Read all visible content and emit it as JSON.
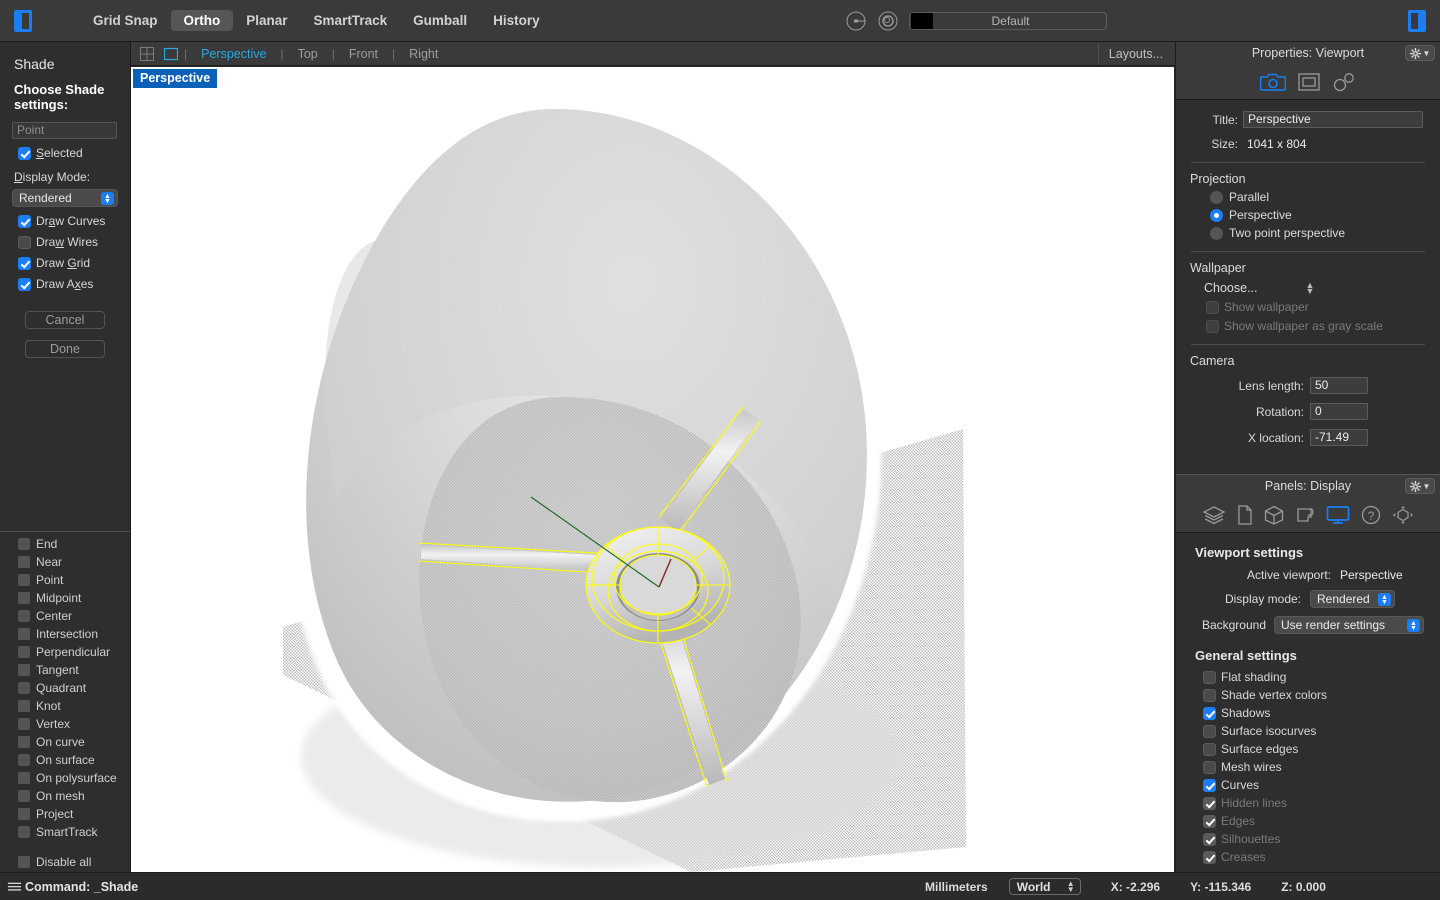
{
  "toolbar": {
    "left_panel_toggle": "left-panel-toggle",
    "right_panel_toggle": "right-panel-toggle",
    "items": [
      {
        "label": "Grid Snap",
        "active": false
      },
      {
        "label": "Ortho",
        "active": true
      },
      {
        "label": "Planar",
        "active": false
      },
      {
        "label": "SmartTrack",
        "active": false
      },
      {
        "label": "Gumball",
        "active": false
      },
      {
        "label": "History",
        "active": false
      }
    ],
    "layer_color": "#000000",
    "layer_name": "Default",
    "accent": "#1b7ef5"
  },
  "viewport_tabs": {
    "names": [
      {
        "label": "Perspective",
        "active": true
      },
      {
        "label": "Top",
        "active": false
      },
      {
        "label": "Front",
        "active": false
      },
      {
        "label": "Right",
        "active": false
      }
    ],
    "layouts_label": "Layouts..."
  },
  "viewport": {
    "label": "Perspective",
    "background": "#ffffff",
    "curve_color": "#ffff00",
    "x_axis_color": "#8a2020",
    "y_axis_color": "#1f6b2a"
  },
  "shade_panel": {
    "title": "Shade",
    "subtitle": "Choose Shade settings:",
    "input_placeholder": "Point",
    "input_value": "",
    "selected": {
      "label": "Selected",
      "checked": true
    },
    "display_mode_label": "Display Mode:",
    "display_mode_value": "Rendered",
    "options": [
      {
        "label": "Draw Curves",
        "checked": true
      },
      {
        "label": "Draw Wires",
        "checked": false
      },
      {
        "label": "Draw Grid",
        "checked": true
      },
      {
        "label": "Draw Axes",
        "checked": true
      }
    ],
    "cancel_label": "Cancel",
    "done_label": "Done"
  },
  "osnap_panel": {
    "items": [
      {
        "label": "End",
        "checked": false
      },
      {
        "label": "Near",
        "checked": false
      },
      {
        "label": "Point",
        "checked": false
      },
      {
        "label": "Midpoint",
        "checked": false
      },
      {
        "label": "Center",
        "checked": false
      },
      {
        "label": "Intersection",
        "checked": false
      },
      {
        "label": "Perpendicular",
        "checked": false
      },
      {
        "label": "Tangent",
        "checked": false
      },
      {
        "label": "Quadrant",
        "checked": false
      },
      {
        "label": "Knot",
        "checked": false
      },
      {
        "label": "Vertex",
        "checked": false
      },
      {
        "label": "On curve",
        "checked": false
      },
      {
        "label": "On surface",
        "checked": false
      },
      {
        "label": "On polysurface",
        "checked": false
      },
      {
        "label": "On mesh",
        "checked": false
      },
      {
        "label": "Project",
        "checked": false
      },
      {
        "label": "SmartTrack",
        "checked": false
      }
    ],
    "disable_all": {
      "label": "Disable all",
      "checked": false
    }
  },
  "properties": {
    "header": "Properties: Viewport",
    "tabs": [
      {
        "name": "camera-icon",
        "active": true
      },
      {
        "name": "viewport-frame-icon",
        "active": false
      },
      {
        "name": "link-chain-icon",
        "active": false
      }
    ],
    "title_label": "Title:",
    "title_value": "Perspective",
    "size_label": "Size:",
    "size_value": "1041 x 804",
    "projection_title": "Projection",
    "projection_options": [
      {
        "label": "Parallel",
        "selected": false
      },
      {
        "label": "Perspective",
        "selected": true
      },
      {
        "label": "Two point perspective",
        "selected": false
      }
    ],
    "wallpaper_title": "Wallpaper",
    "wallpaper_choose": "Choose...",
    "wallpaper_checks": [
      {
        "label": "Show wallpaper",
        "checked": false,
        "disabled": true
      },
      {
        "label": "Show wallpaper as gray scale",
        "checked": false,
        "disabled": true
      }
    ],
    "camera_title": "Camera",
    "camera_fields": [
      {
        "label": "Lens length:",
        "value": "50"
      },
      {
        "label": "Rotation:",
        "value": "0"
      },
      {
        "label": "X location:",
        "value": "-71.49"
      }
    ]
  },
  "display_panel": {
    "header": "Panels: Display",
    "tabs": [
      {
        "name": "layers-icon",
        "active": false
      },
      {
        "name": "notes-page-icon",
        "active": false
      },
      {
        "name": "object-cube-icon",
        "active": false
      },
      {
        "name": "named-views-icon",
        "active": false
      },
      {
        "name": "display-monitor-icon",
        "active": true
      },
      {
        "name": "help-question-icon",
        "active": false
      },
      {
        "name": "navigation-gizmo-icon",
        "active": false
      }
    ],
    "viewport_settings_title": "Viewport settings",
    "active_viewport_label": "Active viewport:",
    "active_viewport_value": "Perspective",
    "display_mode_label": "Display mode:",
    "display_mode_value": "Rendered",
    "background_label": "Background",
    "background_value": "Use render settings",
    "general_settings_title": "General settings",
    "general_settings": [
      {
        "label": "Flat shading",
        "checked": false,
        "disabled": false
      },
      {
        "label": "Shade vertex colors",
        "checked": false,
        "disabled": false
      },
      {
        "label": "Shadows",
        "checked": true,
        "disabled": false
      },
      {
        "label": "Surface isocurves",
        "checked": false,
        "disabled": false
      },
      {
        "label": "Surface edges",
        "checked": false,
        "disabled": false
      },
      {
        "label": "Mesh wires",
        "checked": false,
        "disabled": false
      },
      {
        "label": "Curves",
        "checked": true,
        "disabled": false
      },
      {
        "label": "Hidden lines",
        "checked": true,
        "disabled": true
      },
      {
        "label": "Edges",
        "checked": true,
        "disabled": true
      },
      {
        "label": "Silhouettes",
        "checked": true,
        "disabled": true
      },
      {
        "label": "Creases",
        "checked": true,
        "disabled": true
      }
    ]
  },
  "status_bar": {
    "command_text": "Command: _Shade",
    "units": "Millimeters",
    "cplane": "World",
    "x": "X: -2.296",
    "y": "Y: -115.346",
    "z": "Z: 0.000"
  }
}
